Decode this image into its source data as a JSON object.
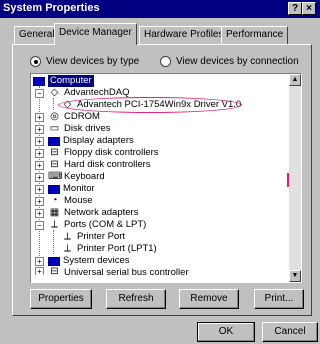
{
  "window": {
    "title": "System Properties",
    "help_btn": "?",
    "close_btn": "×"
  },
  "tabs": [
    {
      "label": "General",
      "active": false
    },
    {
      "label": "Device Manager",
      "active": true
    },
    {
      "label": "Hardware Profiles",
      "active": false
    },
    {
      "label": "Performance",
      "active": false
    }
  ],
  "view": {
    "by_type": "View devices by type",
    "by_connection": "View devices by connection",
    "selected": "by_type"
  },
  "tree": [
    {
      "label": "Computer",
      "icon": "computer-icon",
      "glyph": "▣",
      "selected": true
    },
    {
      "label": "AdvantechDAQ",
      "icon": "daq-icon",
      "glyph": "◇",
      "expander": "−"
    },
    {
      "label": "Advantech PCI-1754Win9x Driver V1.0",
      "icon": "daq-device-icon",
      "glyph": "◇"
    },
    {
      "label": "CDROM",
      "icon": "cdrom-icon",
      "glyph": "◎",
      "expander": "+"
    },
    {
      "label": "Disk drives",
      "icon": "disk-drive-icon",
      "glyph": "▭",
      "expander": "+"
    },
    {
      "label": "Display adapters",
      "icon": "display-adapter-icon",
      "glyph": "▣",
      "expander": "+"
    },
    {
      "label": "Floppy disk controllers",
      "icon": "floppy-controller-icon",
      "glyph": "⊟",
      "expander": "+"
    },
    {
      "label": "Hard disk controllers",
      "icon": "hard-disk-controller-icon",
      "glyph": "⊟",
      "expander": "+"
    },
    {
      "label": "Keyboard",
      "icon": "keyboard-icon",
      "glyph": "⌨",
      "expander": "+"
    },
    {
      "label": "Monitor",
      "icon": "monitor-icon",
      "glyph": "▣",
      "expander": "+"
    },
    {
      "label": "Mouse",
      "icon": "mouse-icon",
      "glyph": "◔",
      "expander": "+"
    },
    {
      "label": "Network adapters",
      "icon": "network-adapter-icon",
      "glyph": "▦",
      "expander": "+"
    },
    {
      "label": "Ports (COM & LPT)",
      "icon": "ports-icon",
      "glyph": "⟂",
      "expander": "−"
    },
    {
      "label": "Printer Port",
      "icon": "printer-port-icon",
      "glyph": "⟂"
    },
    {
      "label": "Printer Port (LPT1)",
      "icon": "printer-port-icon",
      "glyph": "⟂"
    },
    {
      "label": "System devices",
      "icon": "system-devices-icon",
      "glyph": "▣",
      "expander": "+"
    },
    {
      "label": "Universal serial bus controller",
      "icon": "usb-controller-icon",
      "glyph": "⊟",
      "expander": "+"
    }
  ],
  "scrollbar": {
    "up": "▲",
    "down": "▼"
  },
  "buttons": {
    "properties": "Properties",
    "refresh": "Refresh",
    "remove": "Remove",
    "print": "Print...",
    "ok": "OK",
    "cancel": "Cancel"
  }
}
